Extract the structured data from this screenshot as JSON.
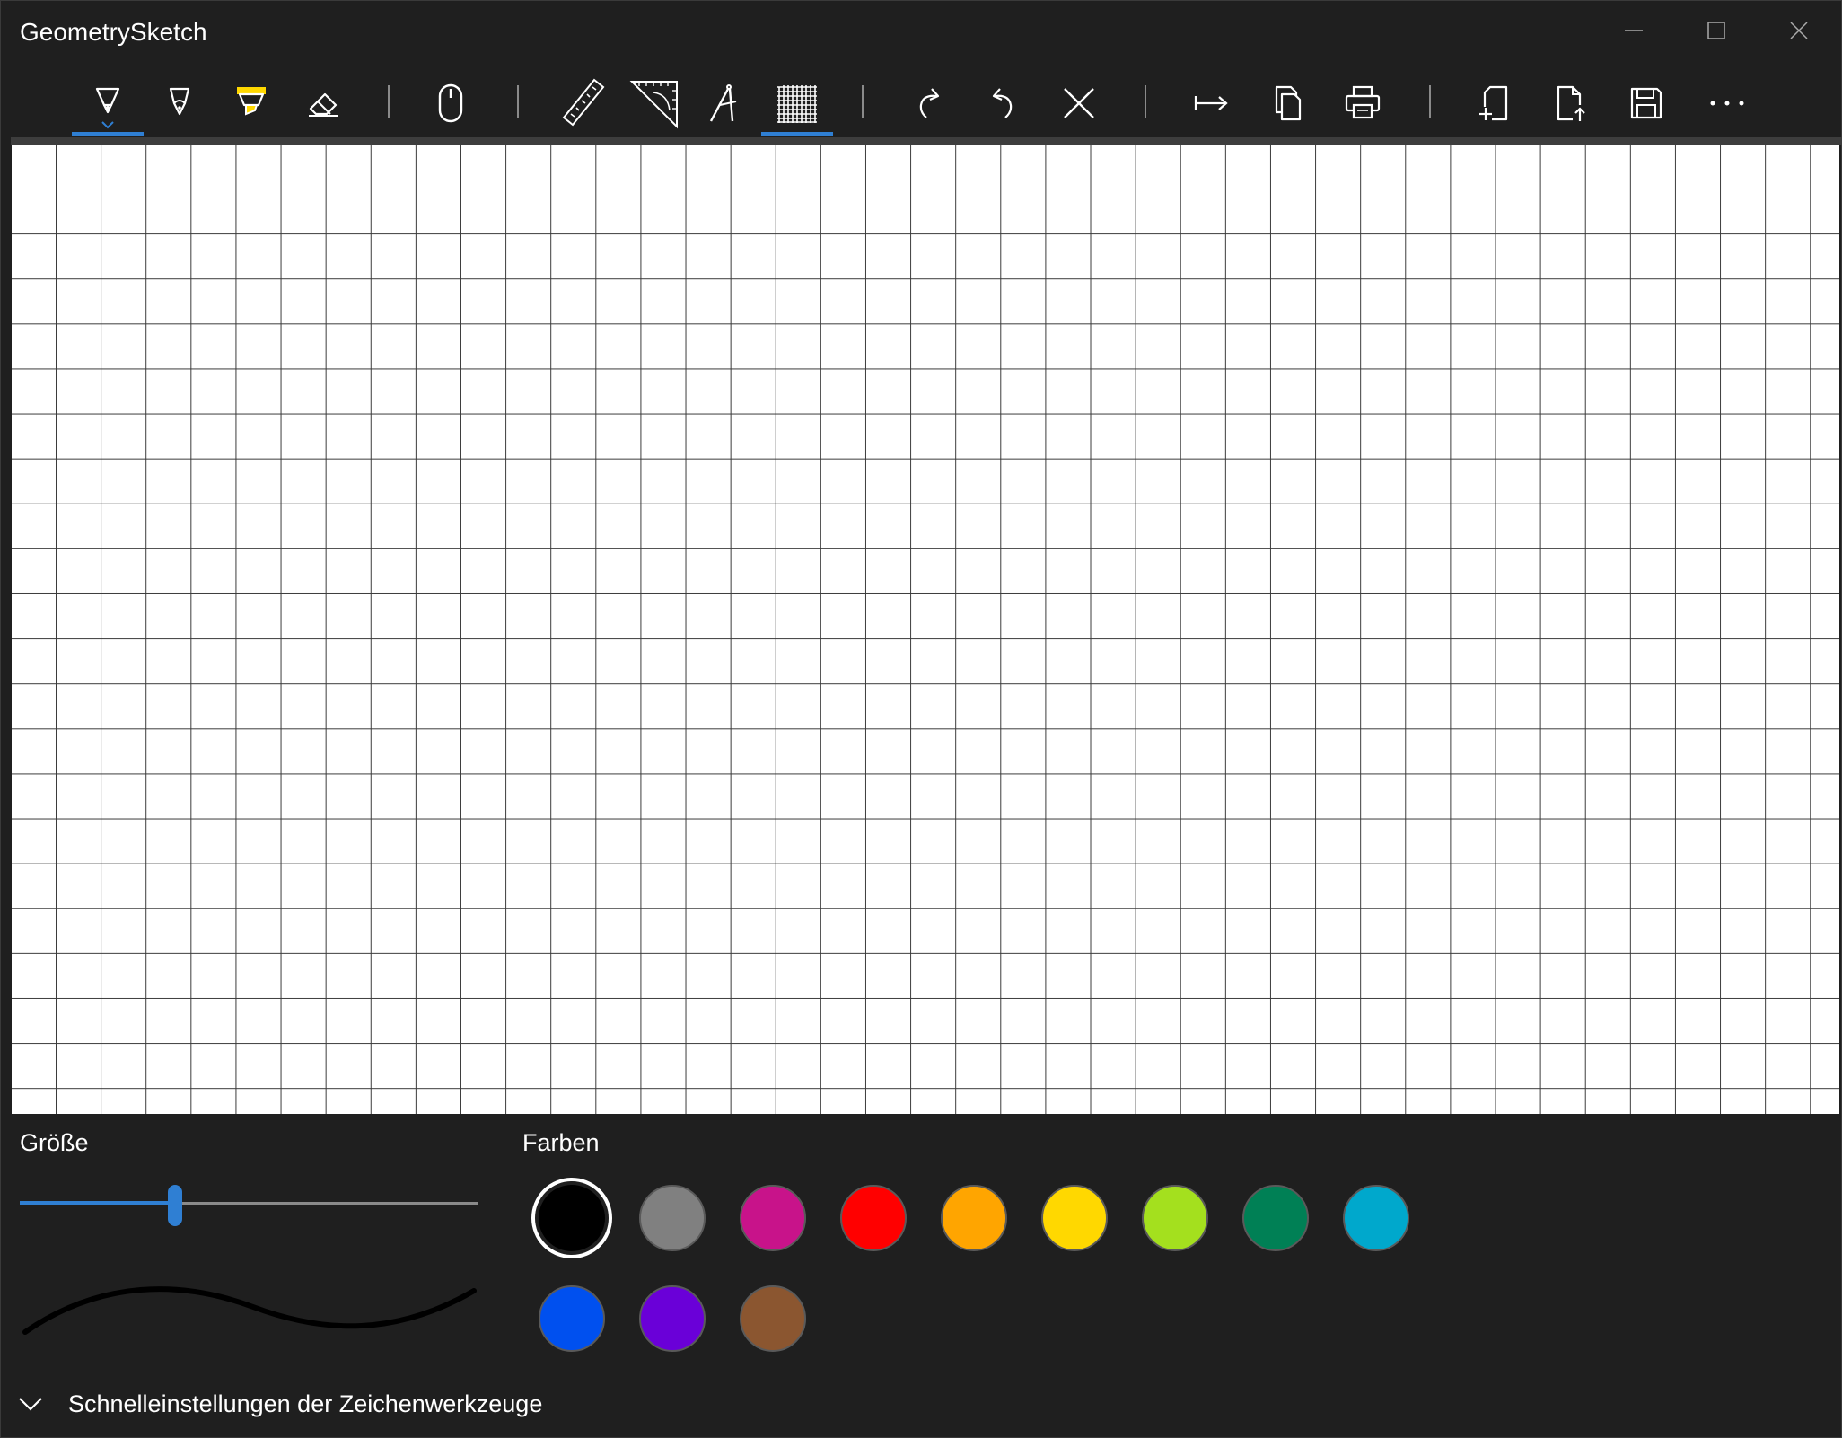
{
  "window": {
    "title": "GeometrySketch"
  },
  "toolbar": {
    "tools": [
      {
        "name": "pen-icon",
        "active": true
      },
      {
        "name": "pencil-icon",
        "active": false
      },
      {
        "name": "highlighter-icon",
        "active": false
      },
      {
        "name": "eraser-icon",
        "active": false
      },
      {
        "name": "mouse-icon",
        "active": false
      },
      {
        "name": "ruler-icon",
        "active": false
      },
      {
        "name": "set-square-icon",
        "active": false
      },
      {
        "name": "compass-icon",
        "active": false
      },
      {
        "name": "grid-icon",
        "active": true
      },
      {
        "name": "redo-icon",
        "active": false
      },
      {
        "name": "undo-icon",
        "active": false
      },
      {
        "name": "clear-icon",
        "active": false
      },
      {
        "name": "extend-canvas-icon",
        "active": false
      },
      {
        "name": "copy-icon",
        "active": false
      },
      {
        "name": "print-icon",
        "active": false
      },
      {
        "name": "new-document-icon",
        "active": false
      },
      {
        "name": "export-icon",
        "active": false
      },
      {
        "name": "save-icon",
        "active": false
      },
      {
        "name": "more-icon",
        "active": false
      }
    ],
    "accent_color": "#2f7fd3",
    "highlighter_color": "#ffd800"
  },
  "canvas": {
    "background": "grid"
  },
  "size_panel": {
    "label": "Größe",
    "slider_value_fraction": 0.34
  },
  "colors_panel": {
    "label": "Farben",
    "selected": "#000000",
    "swatches": [
      "#000000",
      "#808080",
      "#c8138a",
      "#ff0000",
      "#ffa500",
      "#ffd800",
      "#a4e01e",
      "#008055",
      "#00a8cc",
      "#0050ef",
      "#6a00d8",
      "#8b5630"
    ]
  },
  "quick_settings": {
    "label": "Schnelleinstellungen der Zeichenwerkzeuge",
    "icon": "chevron-down-icon"
  }
}
